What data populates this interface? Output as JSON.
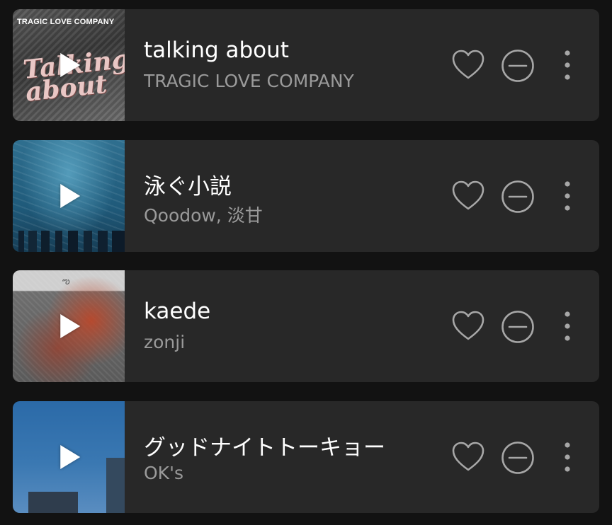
{
  "tracks": [
    {
      "title": "talking about",
      "artist": "TRAGIC LOVE COMPANY",
      "art_text": "TRAGIC LOVE COMPANY",
      "art_script": "Talking about"
    },
    {
      "title": "泳ぐ小説",
      "artist": "Qoodow, 淡甘"
    },
    {
      "title": "kaede",
      "artist": "zonji"
    },
    {
      "title": "グッドナイトトーキョー",
      "artist": "OK's"
    }
  ],
  "icons": {
    "play": "play-icon",
    "like": "heart-icon",
    "hide": "minus-circle-icon",
    "more": "more-vertical-icon"
  },
  "colors": {
    "background": "#121212",
    "row": "#282828",
    "title": "#ffffff",
    "subtitle": "#9a9a9a",
    "icon": "#a7a7a7"
  }
}
